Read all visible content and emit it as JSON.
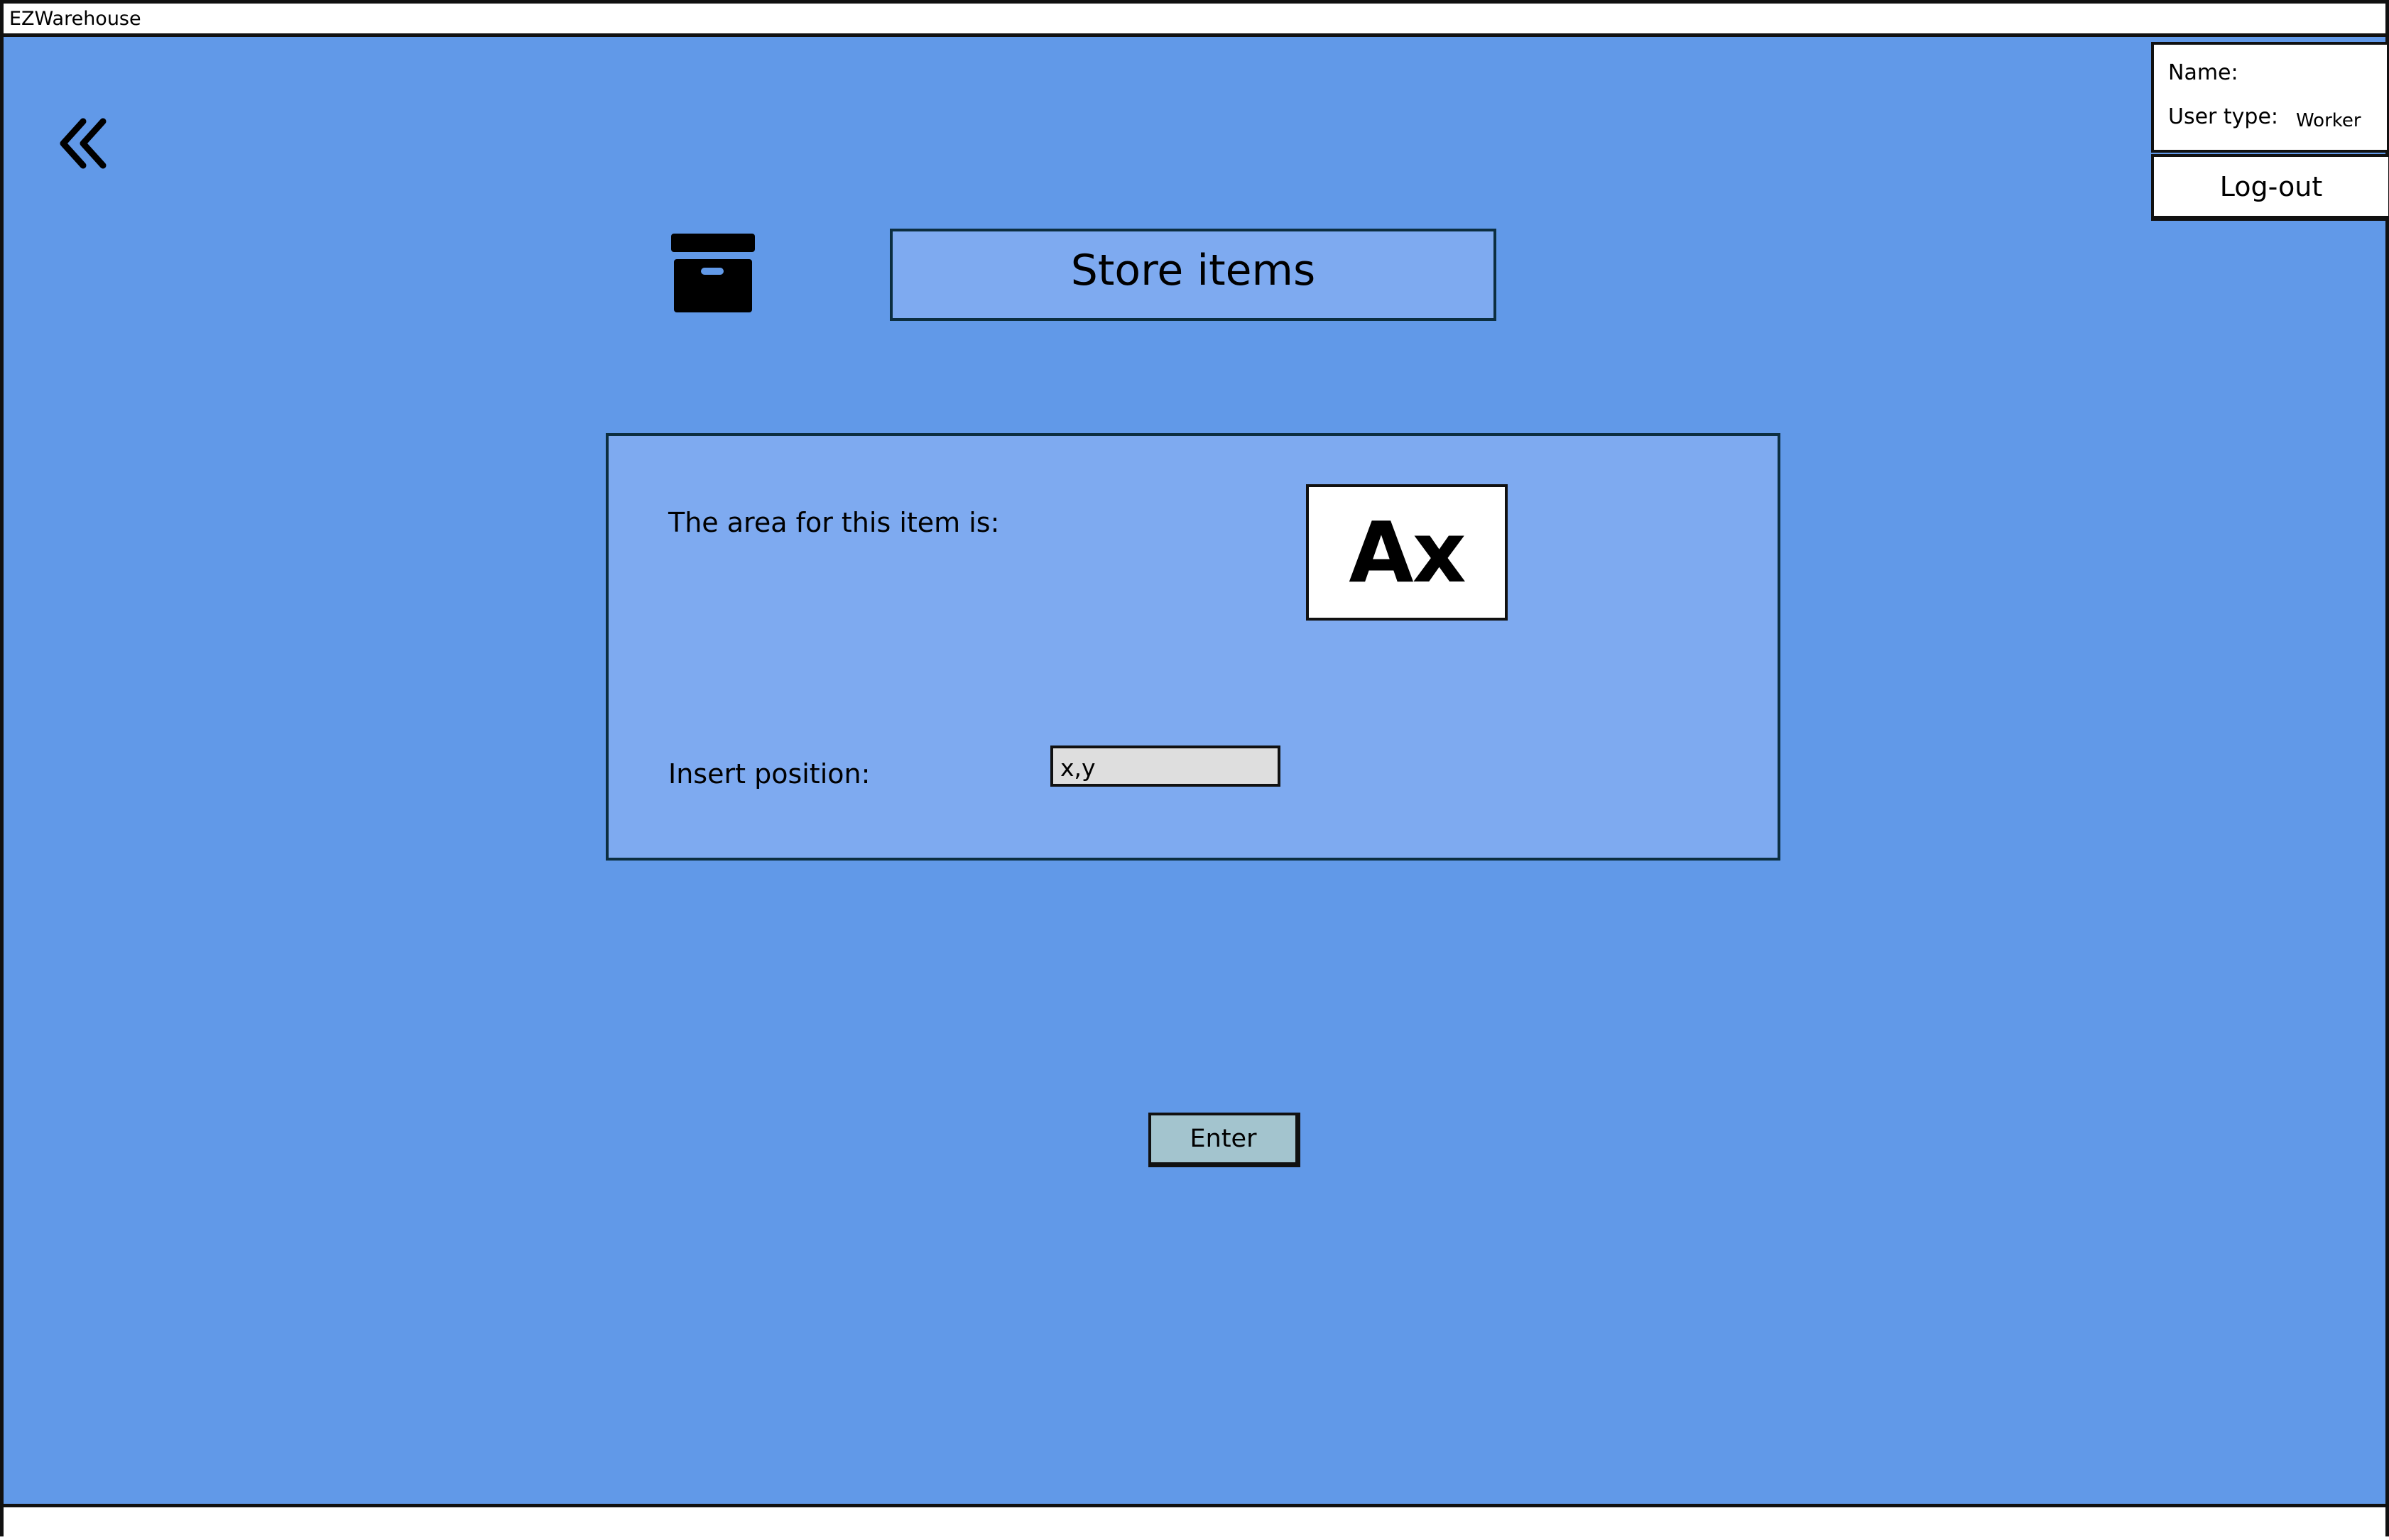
{
  "app": {
    "title": "EZWarehouse"
  },
  "navigation": {
    "back_icon": "double-chevron-left-icon"
  },
  "header": {
    "icon": "archive-box-icon",
    "title": "Store items"
  },
  "panel": {
    "area_label": "The area for this item is:",
    "area_value": "Ax",
    "position_label": "Insert position:",
    "position_value": "x,y"
  },
  "actions": {
    "enter_label": "Enter"
  },
  "user": {
    "name_label": "Name:",
    "name_value": "",
    "type_label": "User type:",
    "type_value": "Worker",
    "logout_label": "Log-out"
  },
  "colors": {
    "background": "#6199e8",
    "panel": "#7eaaf0",
    "enter_button": "#a3c4ce",
    "input": "#dedede"
  }
}
